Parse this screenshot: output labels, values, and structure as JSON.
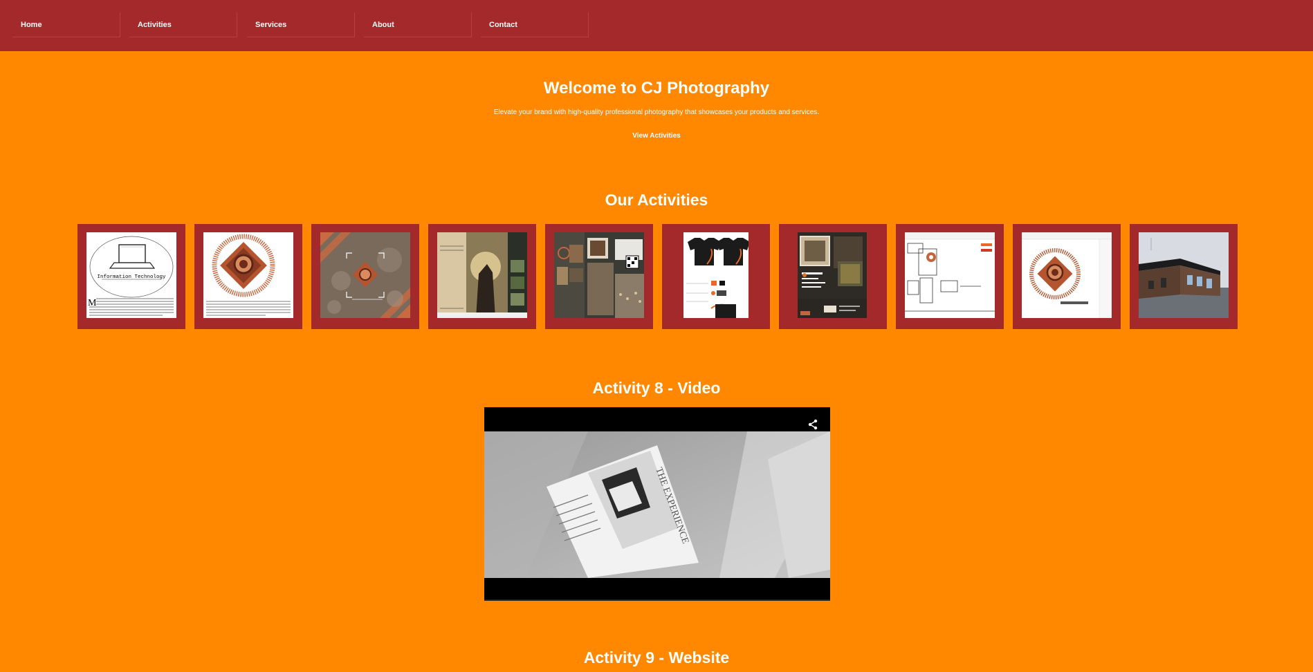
{
  "nav": {
    "items": [
      {
        "label": "Home"
      },
      {
        "label": "Activities"
      },
      {
        "label": "Services"
      },
      {
        "label": "About"
      },
      {
        "label": "Contact"
      }
    ]
  },
  "hero": {
    "title": "Welcome to CJ Photography",
    "subtitle": "Elevate your brand with high-quality professional photography that showcases your products and services.",
    "cta_label": "View Activities"
  },
  "activities": {
    "heading": "Our Activities",
    "thumbnails": [
      {
        "icon": "information-technology-cover",
        "caption": "Information Technology"
      },
      {
        "icon": "logo-document"
      },
      {
        "icon": "logo-bokeh-poster"
      },
      {
        "icon": "couple-photo-brochure"
      },
      {
        "icon": "photo-collage-brochure"
      },
      {
        "icon": "shirt-design"
      },
      {
        "icon": "photo-flyer"
      },
      {
        "icon": "software-screenshot"
      },
      {
        "icon": "logo-software-screenshot"
      },
      {
        "icon": "3d-building-render"
      }
    ]
  },
  "video_section": {
    "heading": "Activity 8 - Video",
    "frame_text": "THE EXPERIENCE",
    "share_icon": "share-icon"
  },
  "website_section": {
    "heading": "Activity 9 - Website"
  },
  "colors": {
    "page_bg": "#ff8800",
    "nav_bg": "#a3292b",
    "card_bg": "#a3292b",
    "text": "#ffffff"
  }
}
